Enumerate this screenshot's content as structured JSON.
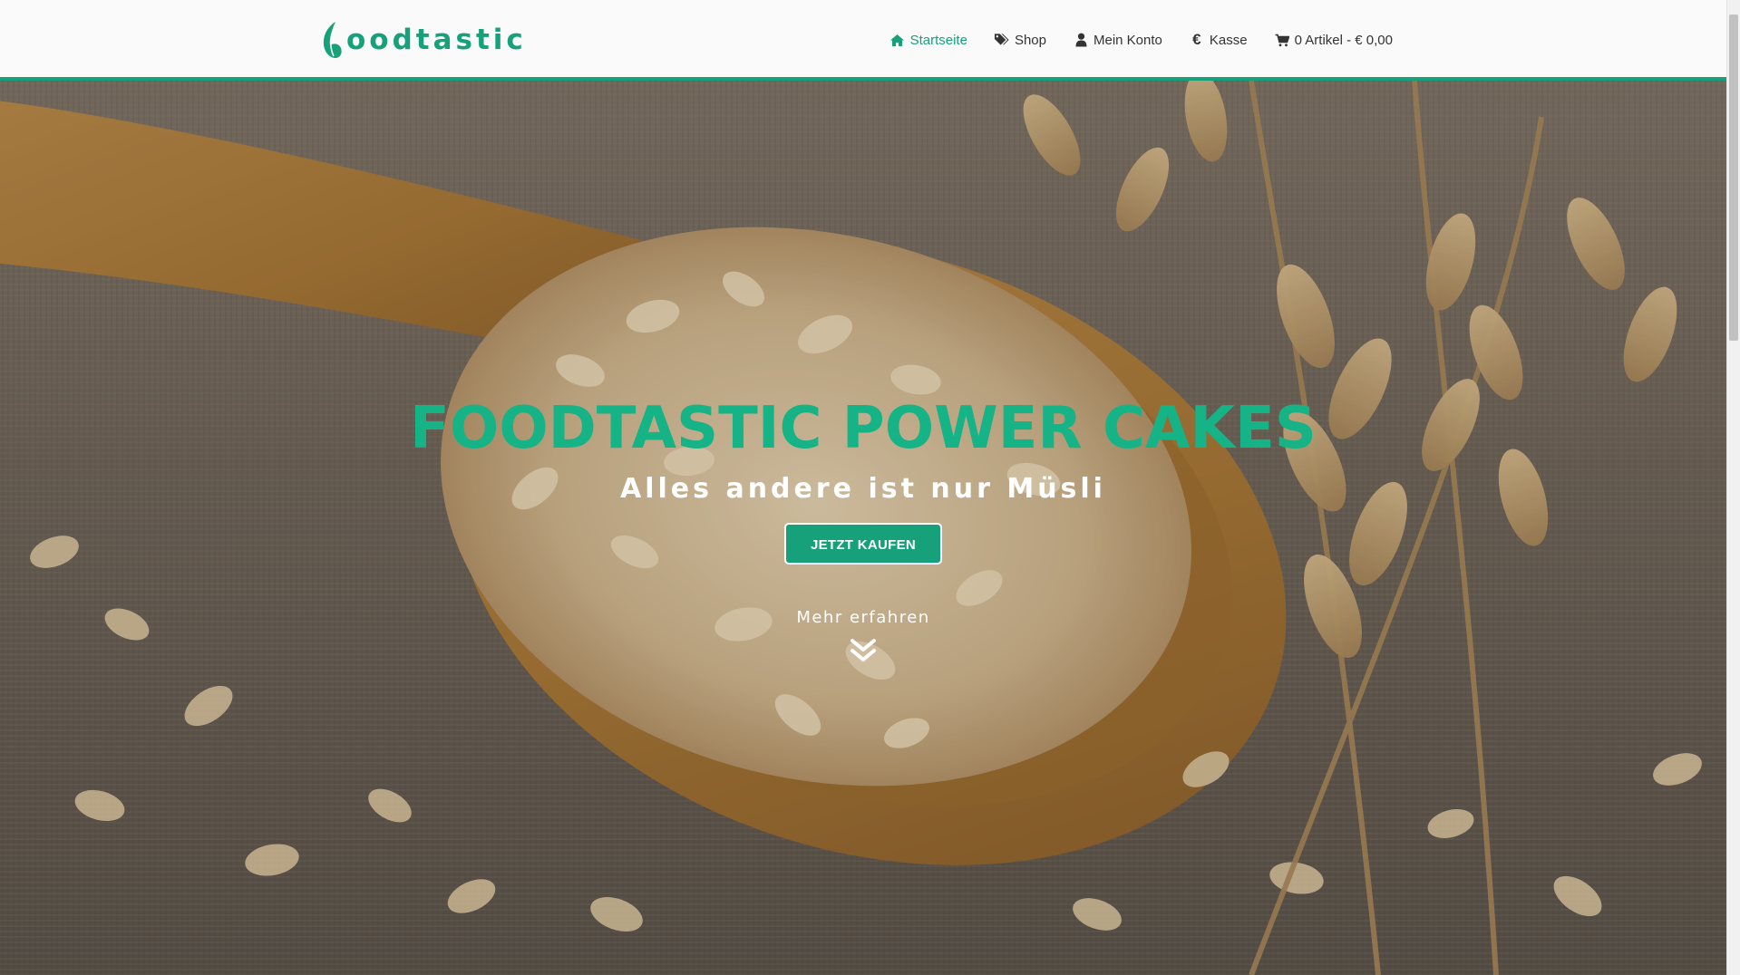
{
  "brand": {
    "name": "foodtastic",
    "text_after_leaf": "oodtastic",
    "color": "#16a17a"
  },
  "nav": {
    "items": [
      {
        "label": "Startseite",
        "icon": "home-icon",
        "active": true
      },
      {
        "label": "Shop",
        "icon": "tags-icon",
        "active": false
      },
      {
        "label": "Mein Konto",
        "icon": "user-icon",
        "active": false
      },
      {
        "label": "Kasse",
        "icon": "euro-icon",
        "active": false
      },
      {
        "label": "0 Artikel - € 0,00",
        "icon": "cart-icon",
        "active": false
      }
    ],
    "euro_glyph": "€"
  },
  "hero": {
    "title": "FOODTASTIC POWER CAKES",
    "subtitle": "Alles andere ist nur Müsli",
    "cta_label": "JETZT KAUFEN",
    "more_label": "Mehr erfahren",
    "more_icon": "double-chevron-down-icon",
    "title_color": "#16b386",
    "button_color": "#16a17a"
  }
}
